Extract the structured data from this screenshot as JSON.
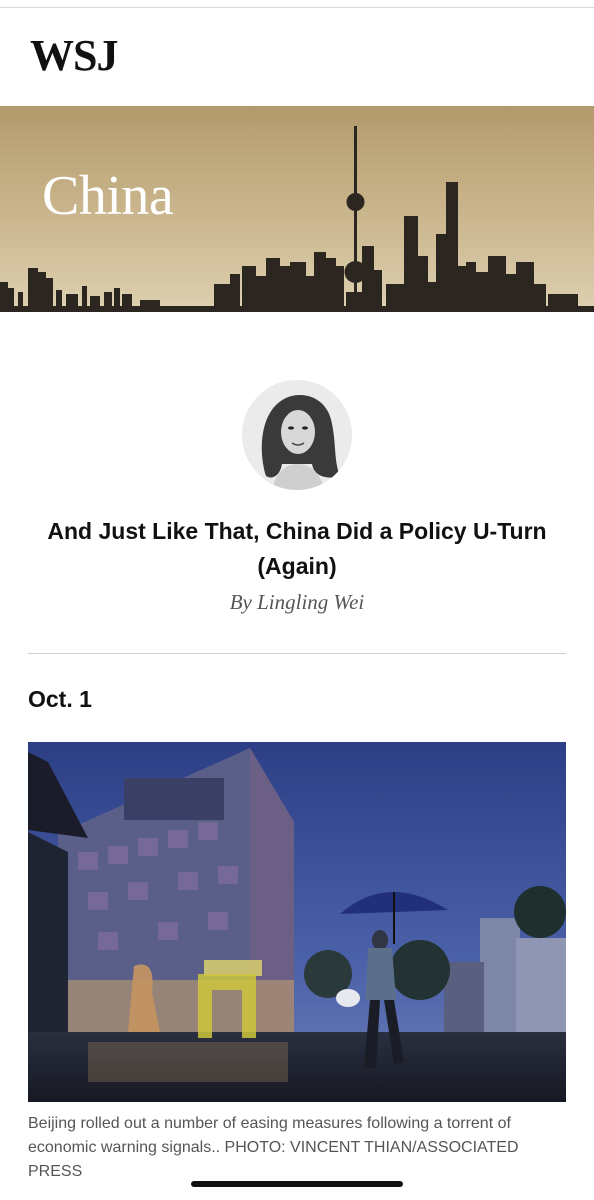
{
  "header": {
    "logo": "WSJ"
  },
  "banner": {
    "section_title": "China",
    "tone": "#c8b48a"
  },
  "article": {
    "author_avatar": "author-portrait",
    "headline": "And Just Like That, China Did a Policy U-Turn (Again)",
    "byline": "By Lingling Wei"
  },
  "entry": {
    "date": "Oct. 1",
    "photo": "rainy-beijing-street-with-umbrella",
    "caption": "Beijing rolled out a number of easing measures following a torrent of economic warning signals.. PHOTO: VINCENT THIAN/ASSOCIATED PRESS"
  }
}
